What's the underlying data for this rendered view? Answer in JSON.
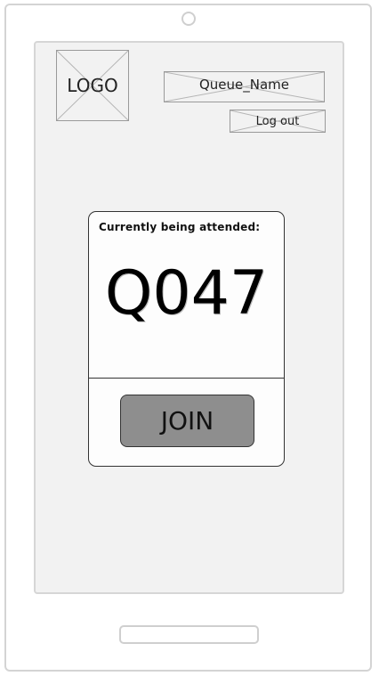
{
  "header": {
    "logo_label": "LOGO",
    "queue_name": "Queue_Name",
    "logout_label": "Log out"
  },
  "card": {
    "status_label": "Currently being attended:",
    "ticket_number": "Q047",
    "join_label": "JOIN"
  },
  "colors": {
    "screen_bg": "#f2f2f2",
    "join_button_bg": "#8e8e8e",
    "card_bg": "#fdfdfd"
  }
}
